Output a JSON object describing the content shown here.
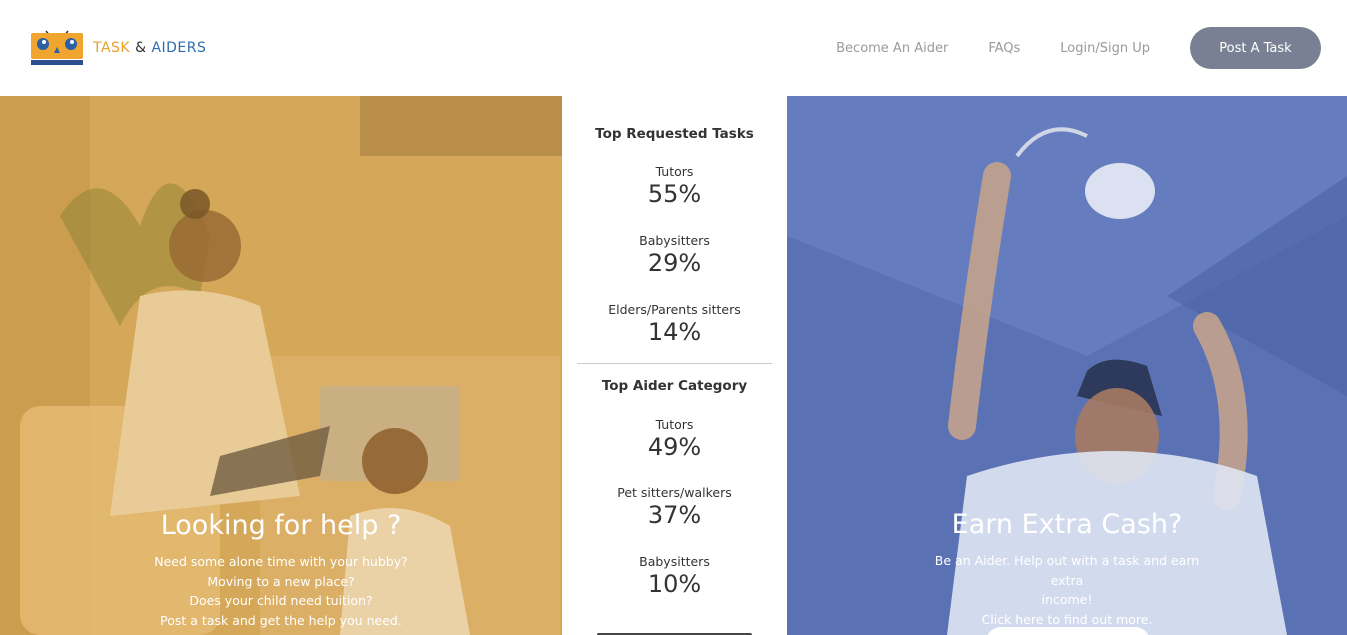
{
  "brand": {
    "part1": "TASK",
    "amp": "&",
    "part2": "AIDERS",
    "colors": {
      "orange": "#e8a02b",
      "blue": "#2b6cb0"
    }
  },
  "nav": {
    "become_aider": "Become An Aider",
    "faqs": "FAQs",
    "login": "Login/Sign Up",
    "post_task": "Post A Task"
  },
  "left_hero": {
    "title": "Looking for help ?",
    "lines": [
      "Need some alone time with your hubby?",
      "Moving to a new place?",
      "Does your child need tuition?",
      "Post a task and get the help you need."
    ]
  },
  "stats": {
    "requested": {
      "heading": "Top Requested Tasks",
      "items": [
        {
          "label": "Tutors",
          "value": "55%"
        },
        {
          "label": "Babysitters",
          "value": "29%"
        },
        {
          "label": "Elders/Parents sitters",
          "value": "14%"
        }
      ]
    },
    "aider": {
      "heading": "Top Aider Category",
      "items": [
        {
          "label": "Tutors",
          "value": "49%"
        },
        {
          "label": "Pet sitters/walkers",
          "value": "37%"
        },
        {
          "label": "Babysitters",
          "value": "10%"
        }
      ]
    }
  },
  "right_hero": {
    "title": "Earn Extra Cash?",
    "lines": [
      "Be an Aider. Help out with a task and earn extra",
      "income!",
      "Click here to find out more."
    ]
  }
}
